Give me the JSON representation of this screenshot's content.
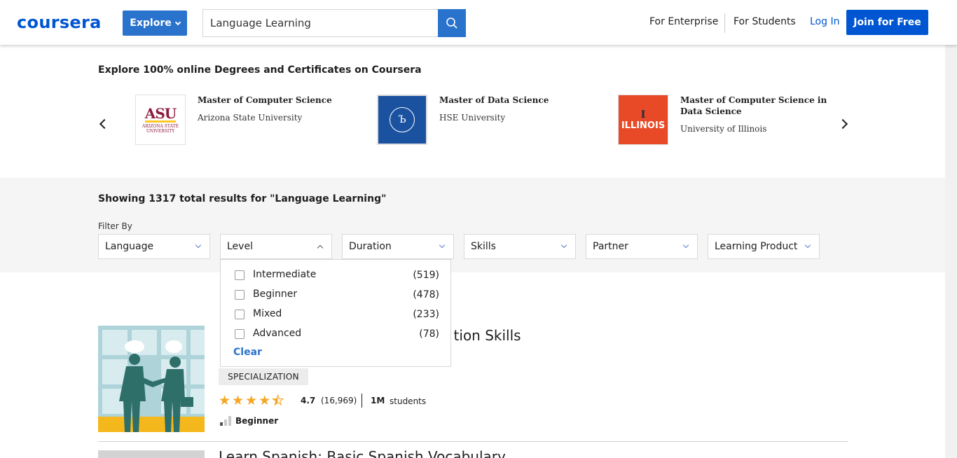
{
  "header": {
    "logo": "coursera",
    "explore_label": "Explore",
    "search_value": "Language Learning",
    "nav": {
      "enterprise": "For Enterprise",
      "students": "For Students",
      "login": "Log In",
      "join": "Join for Free"
    }
  },
  "degrees": {
    "title": "Explore 100% online Degrees and Certificates on Coursera",
    "cards": [
      {
        "title": "Master of Computer Science",
        "university": "Arizona State University",
        "logo_text": "ASU",
        "logo_sub": "ARIZONA STATE UNIVERSITY"
      },
      {
        "title": "Master of Data Science",
        "university": "HSE University",
        "logo_text": "Ъ"
      },
      {
        "title": "Master of Computer Science in Data Science",
        "university": "University of Illinois",
        "logo_text": "ILLINOIS",
        "logo_mark": "I"
      }
    ]
  },
  "results": {
    "summary": "Showing 1317 total results for \"Language Learning\"",
    "filter_label": "Filter By",
    "filters": [
      "Language",
      "Level",
      "Duration",
      "Skills",
      "Partner",
      "Learning Product"
    ]
  },
  "level_dropdown": {
    "options": [
      {
        "label": "Intermediate",
        "count": "(519)"
      },
      {
        "label": "Beginner",
        "count": "(478)"
      },
      {
        "label": "Mixed",
        "count": "(233)"
      },
      {
        "label": "Advanced",
        "count": "(78)"
      }
    ],
    "clear": "Clear"
  },
  "course": {
    "title_visible": "tion Skills",
    "badge": "SPECIALIZATION",
    "rating": "4.7",
    "rating_value": 4.5,
    "reviews": "(16,969)",
    "students_count": "1M",
    "students_label": "students",
    "level": "Beginner"
  },
  "next_course": {
    "title": "Learn Spanish: Basic Spanish Vocabulary"
  },
  "colors": {
    "brand": "#0056d2",
    "accent": "#2a73cc",
    "star": "#f5a623"
  }
}
